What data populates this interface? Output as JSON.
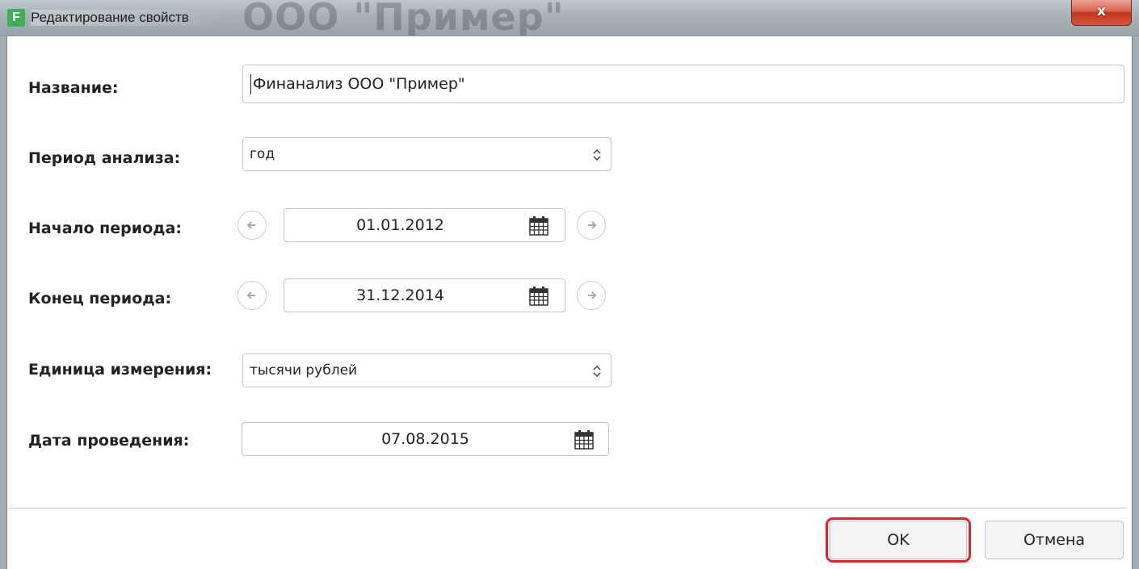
{
  "window": {
    "title": "Редактирование свойств",
    "background_text": "ООО \"Пример\"",
    "close_glyph": "x",
    "app_icon_letter": "F",
    "accent_color": "#3fae55"
  },
  "form": {
    "name": {
      "label": "Название:",
      "value": "Финанализ ООО \"Пример\""
    },
    "period": {
      "label": "Период анализа:",
      "value": "год"
    },
    "start": {
      "label": "Начало периода:",
      "value": "01.01.2012"
    },
    "end": {
      "label": "Конец периода:",
      "value": "31.12.2014"
    },
    "unit": {
      "label": "Единица измерения:",
      "value": "тысячи рублей"
    },
    "date": {
      "label": "Дата проведения:",
      "value": "07.08.2015"
    }
  },
  "buttons": {
    "ok": "OK",
    "cancel": "Отмена",
    "highlight_color": "#e22424"
  }
}
